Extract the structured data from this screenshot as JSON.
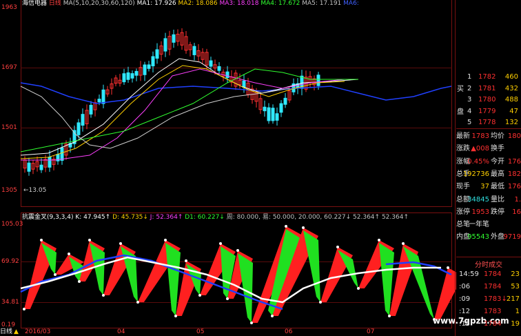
{
  "upper_legend": {
    "name": "海信电器",
    "period": "日线",
    "ma_label": "MA(5,10,20,30,60,120)",
    "items": [
      {
        "t": "MA1: 17.926",
        "c": "#ffffff"
      },
      {
        "t": "MA2: 18.086",
        "c": "#ffd000"
      },
      {
        "t": "MA3: 18.018",
        "c": "#ff40ff"
      },
      {
        "t": "MA4: 17.672",
        "c": "#30ff30"
      },
      {
        "t": "MA5: 17.191",
        "c": "#c0c0c0"
      },
      {
        "t": "MA6:",
        "c": "#4060ff"
      }
    ]
  },
  "upper_axis": {
    "top": "1963",
    "mid": "1697",
    "low": "1501",
    "bottom": "1305",
    "min_note": "13.05"
  },
  "lower_axis": {
    "top": "105.03",
    "mid": "69.92",
    "low": "34.81",
    "bottom": "0.19"
  },
  "lower_legend": [
    {
      "t": "抗震金叉(9,3,3,4)",
      "c": "#ffffff"
    },
    {
      "t": "K: 47.945↑",
      "c": "#ffffff"
    },
    {
      "t": "D: 45.735↓",
      "c": "#ffd000"
    },
    {
      "t": "J: 52.364↑",
      "c": "#ff40ff"
    },
    {
      "t": "D1: 60.227↓",
      "c": "#30ff30"
    },
    {
      "t": "周: 80.000,",
      "c": "#c0c0c0"
    },
    {
      "t": "易: 50.000, 20.000,",
      "c": "#c0c0c0"
    },
    {
      "t": "60.227↓",
      "c": "#c0c0c0"
    },
    {
      "t": "52.364↑",
      "c": "#c0c0c0"
    },
    {
      "t": "52.364↑",
      "c": "#c0c0c0"
    }
  ],
  "x_axis": [
    "2016/03",
    "04",
    "05",
    "06",
    "07"
  ],
  "tabs": [
    "日线",
    "▲"
  ],
  "watermark": "www.7gpzb.com",
  "order_book": {
    "side_labels": [
      "买",
      "盘"
    ],
    "rows": [
      {
        "n": "1",
        "p": "1782",
        "v": "460"
      },
      {
        "n": "2",
        "p": "1781",
        "v": "432"
      },
      {
        "n": "3",
        "p": "1780",
        "v": "488"
      },
      {
        "n": "4",
        "p": "1779",
        "v": "47"
      },
      {
        "n": "5",
        "p": "1778",
        "v": "132"
      }
    ]
  },
  "quote": [
    {
      "l": "最新",
      "v": "1783",
      "l2": "均价",
      "v2": "180"
    },
    {
      "l": "涨跌",
      "v": "▲008",
      "l2": "换手",
      "v2": ""
    },
    {
      "l": "涨幅",
      "v": "0.45%",
      "l2": "今开",
      "v2": "176"
    },
    {
      "l": "总手",
      "v": "192736",
      "l2": "最高",
      "v2": "182"
    },
    {
      "l": "现手",
      "v": "37",
      "l2": "最低",
      "v2": "176"
    },
    {
      "l": "总额",
      "v": "34845",
      "l2": "量比",
      "v2": "1."
    },
    {
      "l": "涨停",
      "v": "1953",
      "l2": "跌停",
      "v2": "16"
    },
    {
      "l": "总笔",
      "v": "一年笔",
      "l2": "",
      "v2": ""
    },
    {
      "l": "内盘",
      "v": "95543",
      "l2": "外盘",
      "v2": "9719"
    }
  ],
  "ticks_header": "分时成交",
  "ticks": [
    {
      "t": "14:59",
      "p": "1784",
      "v": "23"
    },
    {
      "t": ":06",
      "p": "1784",
      "v": "53"
    },
    {
      "t": ":09",
      "p": "1783↓",
      "v": "217"
    },
    {
      "t": ":12",
      "p": "1783",
      "v": "1"
    },
    {
      "t": ":15",
      "p": "1784",
      "v": "19"
    }
  ]
}
